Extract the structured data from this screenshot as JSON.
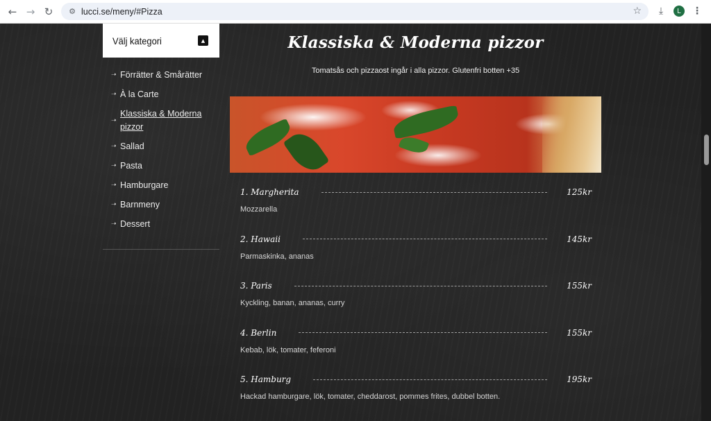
{
  "browser": {
    "url": "lucci.se/meny/#Pizza",
    "profile_initial": "L"
  },
  "sidebar": {
    "title": "Välj kategori",
    "items": [
      {
        "label": "Förrätter & Smårätter"
      },
      {
        "label": "À la Carte"
      },
      {
        "label": "Klassiska & Moderna pizzor",
        "active": true
      },
      {
        "label": "Sallad"
      },
      {
        "label": "Pasta"
      },
      {
        "label": "Hamburgare"
      },
      {
        "label": "Barnmeny"
      },
      {
        "label": "Dessert"
      }
    ]
  },
  "main": {
    "title": "Klassiska & Moderna pizzor",
    "subtitle": "Tomatsås och pizzaost ingår i alla pizzor. Glutenfri botten +35",
    "items": [
      {
        "name": "1. Margherita",
        "price": "125kr",
        "desc": "Mozzarella"
      },
      {
        "name": "2. Hawaii",
        "price": "145kr",
        "desc": "Parmaskinka, ananas"
      },
      {
        "name": "3. Paris",
        "price": "155kr",
        "desc": "Kyckling, banan, ananas, curry"
      },
      {
        "name": "4. Berlin",
        "price": "155kr",
        "desc": "Kebab, lök, tomater, feferoni"
      },
      {
        "name": "5. Hamburg",
        "price": "195kr",
        "desc": "Hackad hamburgare, lök, tomater, cheddarost, pommes frites, dubbel botten."
      }
    ]
  },
  "icons": {
    "back": "back-arrow-icon",
    "forward": "forward-arrow-icon",
    "reload": "reload-icon",
    "site_settings": "site-settings-icon",
    "bookmark": "star-icon",
    "download": "download-icon",
    "menu": "more-vert-icon",
    "category_toggle": "caret-up-icon",
    "category_arrow": "arrow-right-icon"
  }
}
